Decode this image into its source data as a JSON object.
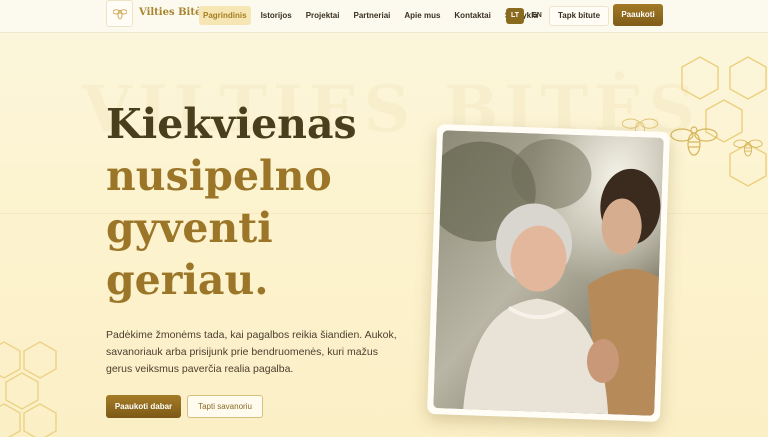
{
  "brand": {
    "name": "Vilties Bitės"
  },
  "nav": {
    "items": [
      {
        "label": "Pagrindinis",
        "active": true
      },
      {
        "label": "Istorijos",
        "active": false
      },
      {
        "label": "Projektai",
        "active": false
      },
      {
        "label": "Partneriai",
        "active": false
      },
      {
        "label": "Apie mus",
        "active": false
      },
      {
        "label": "Kontaktai",
        "active": false
      },
      {
        "label": "Stovykla",
        "active": false
      }
    ]
  },
  "lang": {
    "lt": "LT",
    "en": "EN",
    "selected": "LT"
  },
  "header_buttons": {
    "bite": "Tapk bitute",
    "donate": "Paaukoti"
  },
  "hero": {
    "watermark": "VILTIES BITĖS",
    "title_line1": "Kiekvienas",
    "title_line2": "nusipelno",
    "title_line3": "gyventi",
    "title_line4": "geriau.",
    "text": "Padėkime žmonėms tada, kai pagalbos reikia šiandien. Aukok, savanoriauk arba prisijunk prie bendruomenės, kuri mažus gerus veiksmus paverčia realia pagalba.",
    "primary_button": "Paaukoti dabar",
    "secondary_button": "Tapti savanoriu"
  },
  "colors": {
    "accent": "#9c7628",
    "brand_dark": "#7f5c18",
    "background": "#fbf3cf"
  },
  "icons": [
    "bee-logo-icon",
    "honeycomb-icon",
    "bee-icon"
  ]
}
